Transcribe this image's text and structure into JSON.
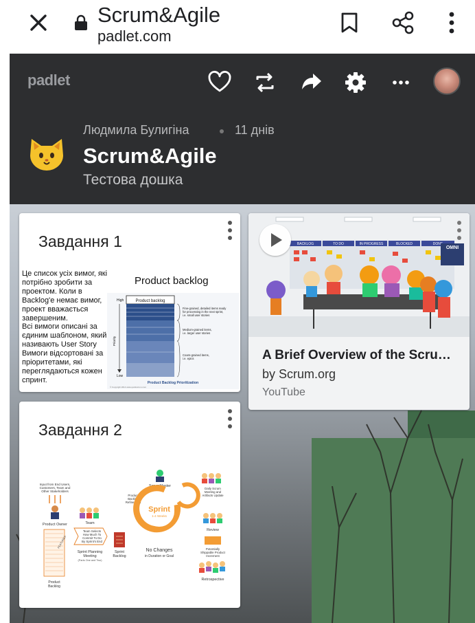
{
  "browser": {
    "title": "Scrum&Agile",
    "url": "padlet.com"
  },
  "header": {
    "logo": "padlet",
    "author": "Людмила Булигіна",
    "time_ago": "11 днів",
    "board_title": "Scrum&Agile",
    "board_subtitle": "Тестова дошка",
    "icons": [
      "heart-icon",
      "remake-icon",
      "share-arrow-icon",
      "gear-icon",
      "more-icon"
    ]
  },
  "cards": [
    {
      "title": "Завдання 1",
      "description_lines": [
        "Це список усіх вимог, які",
        "потрібно зробити за",
        "проектом. Коли в",
        "Backlog'е немає вимог,",
        "проект вважається",
        "завершеним.",
        "Всі вимоги описані за",
        "єдиним шаблоном, який",
        "називають User Story",
        "Вимоги відсортовані за",
        "пріоритетами, які",
        "переглядаються кожен",
        "спринт."
      ],
      "diagram_title": "Product backlog",
      "diagram": {
        "box_label": "Product backlog",
        "high": "High",
        "low": "Low",
        "priority": "Priority",
        "note1a": "Fine-grained, detailed items ready",
        "note1b": "for processing in the next sprint,",
        "note1c": "i.e. small user stories",
        "note2a": "Medium-grained items,",
        "note2b": "i.e. larger user stories",
        "note3a": "Coars-grained items,",
        "note3b": "i.e. epics",
        "caption": "Product Backlog Prioritization",
        "copyright": "© Copyright 2014 www.quickscrum.com"
      }
    },
    {
      "title": "A Brief Overview of the Scru…",
      "byline": "by Scrum.org",
      "source": "YouTube",
      "board_columns": [
        "BACKLOG",
        "TO DO",
        "IN PROGRESS",
        "BLOCKED",
        "DONE"
      ],
      "brand": "OMNI"
    },
    {
      "title": "Завдання 2",
      "diagram": {
        "input_a": "Input from End Users,",
        "input_b": "Customers, Team and",
        "input_c": "Other Stakeholders",
        "product_owner": "Product Owner",
        "team": "Team",
        "scrum_master": "ScrumMaster",
        "refinement_a": "Product",
        "refinement_b": "Backlog",
        "refinement_c": "Refinement",
        "sprint": "Sprint",
        "sprint_weeks": "1-4 Weeks",
        "daily_a": "Daily Scrum",
        "daily_b": "Meeting and",
        "daily_c": "Artifacts Update",
        "review": "Review",
        "team_selects_a": "Team Selects",
        "team_selects_b": "How Much To",
        "team_selects_c": "Commit To Do",
        "team_selects_d": "By Sprint's End",
        "planning_a": "Sprint Planning",
        "planning_b": "Meeting",
        "planning_c": "(Parts One and Two)",
        "sprint_backlog_a": "Sprint",
        "sprint_backlog_b": "Backlog",
        "no_changes_a": "No Changes",
        "no_changes_b": "in Duration or Goal",
        "increment_a": "Potentially",
        "increment_b": "Shippable Product",
        "increment_c": "Increment",
        "retrospective": "Retrospective",
        "product_backlog_a": "Product",
        "product_backlog_b": "Backlog",
        "features": "FEATURES"
      }
    }
  ],
  "colors": {
    "header_bg": "#2d2e30",
    "sprint_orange": "#f39c34",
    "backlog_blue": "#4d6fa8"
  }
}
